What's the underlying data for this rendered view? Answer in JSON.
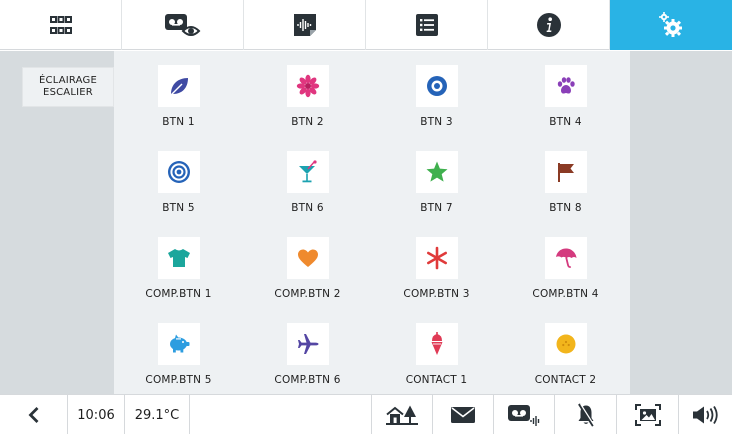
{
  "colors": {
    "accent": "#29b3e5",
    "panel": "#d6dbde",
    "grid_bg": "#eef1f3",
    "icon_dark": "#2a3238"
  },
  "top_tabs": [
    {
      "name": "grid-apps",
      "icon": "grid-icon",
      "active": false
    },
    {
      "name": "video-messages",
      "icon": "video-eye-icon",
      "active": false
    },
    {
      "name": "audio-messages",
      "icon": "audio-note-icon",
      "active": false
    },
    {
      "name": "list",
      "icon": "list-icon",
      "active": false
    },
    {
      "name": "info",
      "icon": "info-icon",
      "active": false
    },
    {
      "name": "settings",
      "icon": "gears-icon",
      "active": true
    }
  ],
  "scene": {
    "line1": "ÉCLAIRAGE",
    "line2": "ESCALIER"
  },
  "buttons": [
    {
      "label": "BTN 1",
      "icon": "leaf-icon",
      "color": "#3f4aa3"
    },
    {
      "label": "BTN 2",
      "icon": "flower-icon",
      "color": "#e0367f"
    },
    {
      "label": "BTN 3",
      "icon": "target-ring-icon",
      "color": "#2563b8"
    },
    {
      "label": "BTN 4",
      "icon": "paw-icon",
      "color": "#8a3fb8"
    },
    {
      "label": "BTN 5",
      "icon": "bullseye-icon",
      "color": "#2563b8"
    },
    {
      "label": "BTN 6",
      "icon": "cocktail-icon",
      "color": "#1ba2b0"
    },
    {
      "label": "BTN 7",
      "icon": "star-icon",
      "color": "#3fb04e"
    },
    {
      "label": "BTN 8",
      "icon": "flag-icon",
      "color": "#8a3a24"
    },
    {
      "label": "COMP.BTN 1",
      "icon": "tshirt-icon",
      "color": "#1ba69c"
    },
    {
      "label": "COMP.BTN 2",
      "icon": "heart-icon",
      "color": "#ef8a2e"
    },
    {
      "label": "COMP.BTN 3",
      "icon": "asterisk-icon",
      "color": "#e03a3a"
    },
    {
      "label": "COMP.BTN 4",
      "icon": "umbrella-icon",
      "color": "#d43a7e"
    },
    {
      "label": "COMP.BTN 5",
      "icon": "piggy-bank-icon",
      "color": "#2d9de0"
    },
    {
      "label": "COMP.BTN 6",
      "icon": "airplane-icon",
      "color": "#5446a3"
    },
    {
      "label": "CONTACT 1",
      "icon": "ice-cream-icon",
      "color": "#e03a55"
    },
    {
      "label": "CONTACT 2",
      "icon": "ball-icon",
      "color": "#f2b51c"
    }
  ],
  "status": {
    "time": "10:06",
    "temperature": "29.1°C"
  },
  "bottom_icons": [
    {
      "name": "home-scene",
      "icon": "house-tree-icon"
    },
    {
      "name": "messages",
      "icon": "envelope-icon"
    },
    {
      "name": "voicemail",
      "icon": "voicemail-icon"
    },
    {
      "name": "do-not-disturb",
      "icon": "bell-off-icon"
    },
    {
      "name": "screen",
      "icon": "image-frame-icon"
    },
    {
      "name": "volume",
      "icon": "speaker-icon"
    }
  ]
}
